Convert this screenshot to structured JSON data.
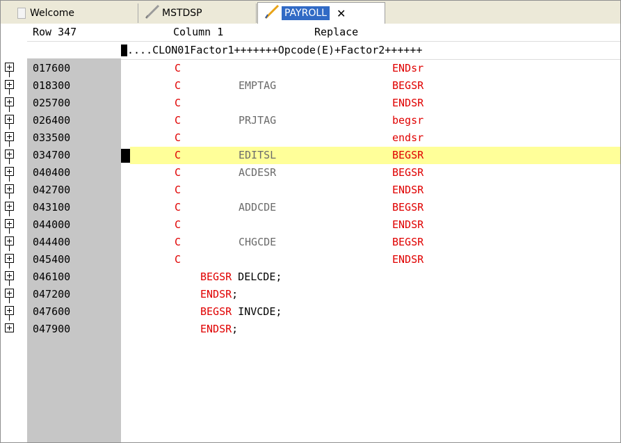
{
  "tabs": [
    {
      "label": "Welcome",
      "icon": "document-icon",
      "active": false
    },
    {
      "label": "MSTDSP",
      "icon": "pencil-icon",
      "active": false
    },
    {
      "label": "PAYROLL",
      "icon": "pencil-icon",
      "active": true,
      "close": "✕"
    }
  ],
  "status": {
    "row": "Row 347",
    "column": "Column 1",
    "mode": "Replace"
  },
  "ruler": "....CLON01Factor1+++++++Opcode(E)+Factor2++++++",
  "colors": {
    "keyword_red": "#e00000",
    "factor_gray": "#6b6b6b",
    "highlight": "#ffff99",
    "sequence_bg": "#c6c6c6"
  },
  "lines": [
    {
      "seq": "017600",
      "spec": "C",
      "factor1": "",
      "opcode": "ENDsr",
      "free": ""
    },
    {
      "seq": "018300",
      "spec": "C",
      "factor1": "EMPTAG",
      "opcode": "BEGSR",
      "free": ""
    },
    {
      "seq": "025700",
      "spec": "C",
      "factor1": "",
      "opcode": "ENDSR",
      "free": ""
    },
    {
      "seq": "026400",
      "spec": "C",
      "factor1": "PRJTAG",
      "opcode": "begsr",
      "free": ""
    },
    {
      "seq": "033500",
      "spec": "C",
      "factor1": "",
      "opcode": "endsr",
      "free": ""
    },
    {
      "seq": "034700",
      "spec": "C",
      "factor1": "EDITSL",
      "opcode": "BEGSR",
      "free": "",
      "highlight": true
    },
    {
      "seq": "040400",
      "spec": "C",
      "factor1": "ACDESR",
      "opcode": "BEGSR",
      "free": ""
    },
    {
      "seq": "042700",
      "spec": "C",
      "factor1": "",
      "opcode": "ENDSR",
      "free": ""
    },
    {
      "seq": "043100",
      "spec": "C",
      "factor1": "ADDCDE",
      "opcode": "BEGSR",
      "free": ""
    },
    {
      "seq": "044000",
      "spec": "C",
      "factor1": "",
      "opcode": "ENDSR",
      "free": ""
    },
    {
      "seq": "044400",
      "spec": "C",
      "factor1": "CHGCDE",
      "opcode": "BEGSR",
      "free": ""
    },
    {
      "seq": "045400",
      "spec": "C",
      "factor1": "",
      "opcode": "ENDSR",
      "free": ""
    },
    {
      "seq": "046100",
      "spec": "",
      "factor1": "",
      "opcode": "",
      "free_kw": "BEGSR",
      "free_rest": " DELCDE;"
    },
    {
      "seq": "047200",
      "spec": "",
      "factor1": "",
      "opcode": "",
      "free_kw": "ENDSR",
      "free_rest": ";"
    },
    {
      "seq": "047600",
      "spec": "",
      "factor1": "",
      "opcode": "",
      "free_kw": "BEGSR",
      "free_rest": " INVCDE;"
    },
    {
      "seq": "047900",
      "spec": "",
      "factor1": "",
      "opcode": "",
      "free_kw": "ENDSR",
      "free_rest": ";"
    }
  ]
}
